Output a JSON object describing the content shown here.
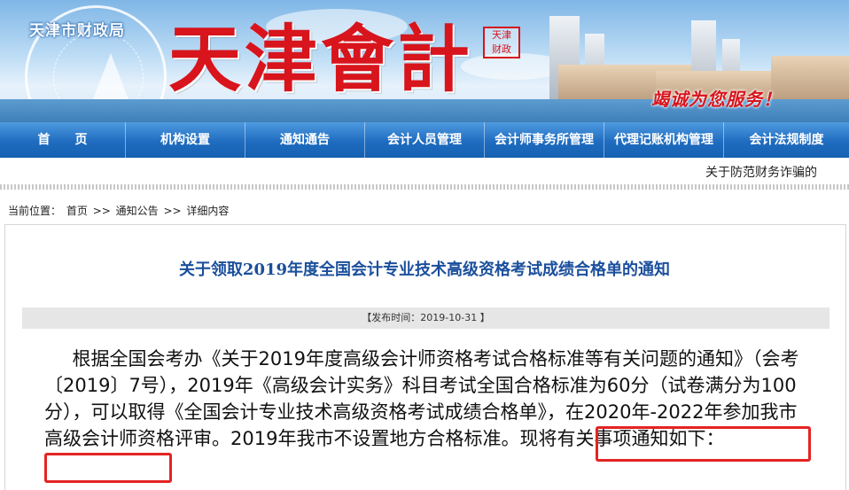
{
  "header": {
    "bureau_name": "天津市财政局",
    "site_title": "天津會計",
    "seal_text": [
      "天津",
      "财政"
    ],
    "slogan": "竭诚为您服务！"
  },
  "nav": {
    "items": [
      {
        "label": "首　　页"
      },
      {
        "label": "机构设置"
      },
      {
        "label": "通知通告"
      },
      {
        "label": "会计人员管理"
      },
      {
        "label": "会计师事务所管理"
      },
      {
        "label": "代理记账机构管理"
      },
      {
        "label": "会计法规制度"
      }
    ]
  },
  "ticker": {
    "text": "关于防范财务诈骗的"
  },
  "breadcrumb": {
    "prefix": "当前位置：",
    "items": [
      "首页",
      "通知公告",
      "详细内容"
    ],
    "separator": ">>"
  },
  "article": {
    "title": "关于领取2019年度全国会计专业技术高级资格考试成绩合格单的通知",
    "publish_time": "【发布时间：2019-10-31 】",
    "paragraph_main": "根据全国会考办《关于2019年度高级会计师资格考试合格标准等有关问题的通知》（会考〔2019〕7号），2019年《高级会计实务》科目考试全国合格标准为60分（试卷满分为100分），可以取得《全国会计专业技术高级资格考试成绩合格单》，在2020年-2022年参加我市高级会计师资格评审。",
    "paragraph_highlight": "2019年我市不设置地方合格标准。",
    "paragraph_tail": "现将有关事项通知如下："
  },
  "colors": {
    "nav_blue": "#1f6cc0",
    "title_red": "#d8141c",
    "article_title_blue": "#1b4f9c",
    "highlight_red": "#e42323"
  }
}
